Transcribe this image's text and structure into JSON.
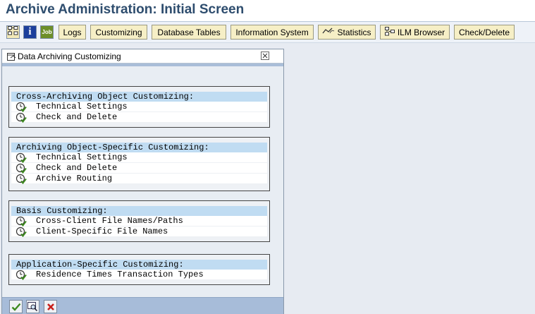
{
  "window": {
    "title": "Archive Administration: Initial Screen"
  },
  "toolbar": {
    "icon_buttons": [
      {
        "name": "hierarchy-icon"
      },
      {
        "name": "info-icon"
      },
      {
        "name": "job-icon",
        "label": "Job"
      }
    ],
    "buttons": [
      {
        "label": "Logs"
      },
      {
        "label": "Customizing"
      },
      {
        "label": "Database Tables"
      },
      {
        "label": "Information System"
      },
      {
        "label": "Statistics",
        "icon": "statistics-icon"
      },
      {
        "label": "ILM Browser",
        "icon": "ilm-icon"
      },
      {
        "label": "Check/Delete"
      }
    ]
  },
  "dialog": {
    "title": "Data Archiving Customizing",
    "groups": [
      {
        "heading": "Cross-Archiving Object Customizing:",
        "items": [
          "Technical Settings",
          "Check and Delete"
        ]
      },
      {
        "heading": "Archiving Object-Specific Customizing:",
        "items": [
          "Technical Settings",
          "Check and Delete",
          "Archive Routing"
        ]
      },
      {
        "heading": "Basis Customizing:",
        "items": [
          "Cross-Client File Names/Paths",
          "Client-Specific File Names"
        ]
      },
      {
        "heading": "Application-Specific Customizing:",
        "items": [
          "Residence Times Transaction Types"
        ]
      }
    ],
    "footer_buttons": [
      "continue-check-icon",
      "find-icon",
      "cancel-icon"
    ]
  },
  "colors": {
    "title_text": "#2e4d6e",
    "button_face": "#f6efc6",
    "group_heading_bg": "#c0dcf2",
    "footer_bg": "#a7bcd9",
    "cancel_red": "#c8201c",
    "check_green": "#3d8a1f"
  }
}
